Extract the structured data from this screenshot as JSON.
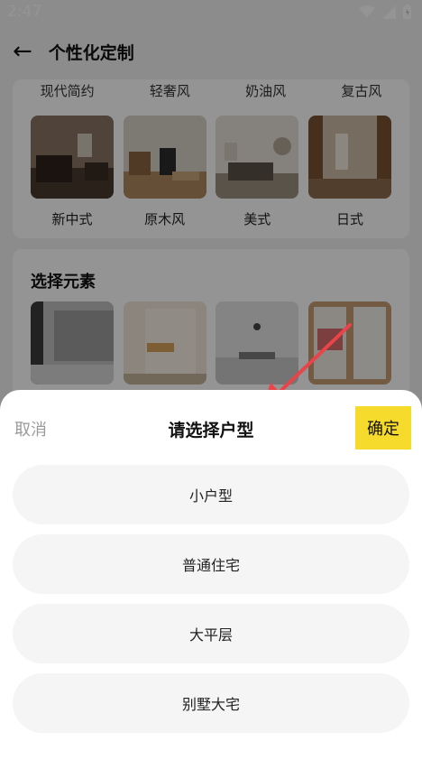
{
  "status_bar": {
    "time": "2:47"
  },
  "header": {
    "title": "个性化定制"
  },
  "styles_section": {
    "top_labels": [
      "现代简约",
      "轻奢风",
      "奶油风",
      "复古风"
    ],
    "items": [
      {
        "label": "新中式"
      },
      {
        "label": "原木风"
      },
      {
        "label": "美式"
      },
      {
        "label": "日式"
      }
    ]
  },
  "elements_section": {
    "heading": "选择元素"
  },
  "sheet": {
    "cancel_label": "取消",
    "title": "请选择户型",
    "confirm_label": "确定",
    "options": [
      "小户型",
      "普通住宅",
      "大平层",
      "别墅大宅"
    ]
  },
  "colors": {
    "confirm_bg": "#f7db2c",
    "arrow": "#e8444a"
  }
}
